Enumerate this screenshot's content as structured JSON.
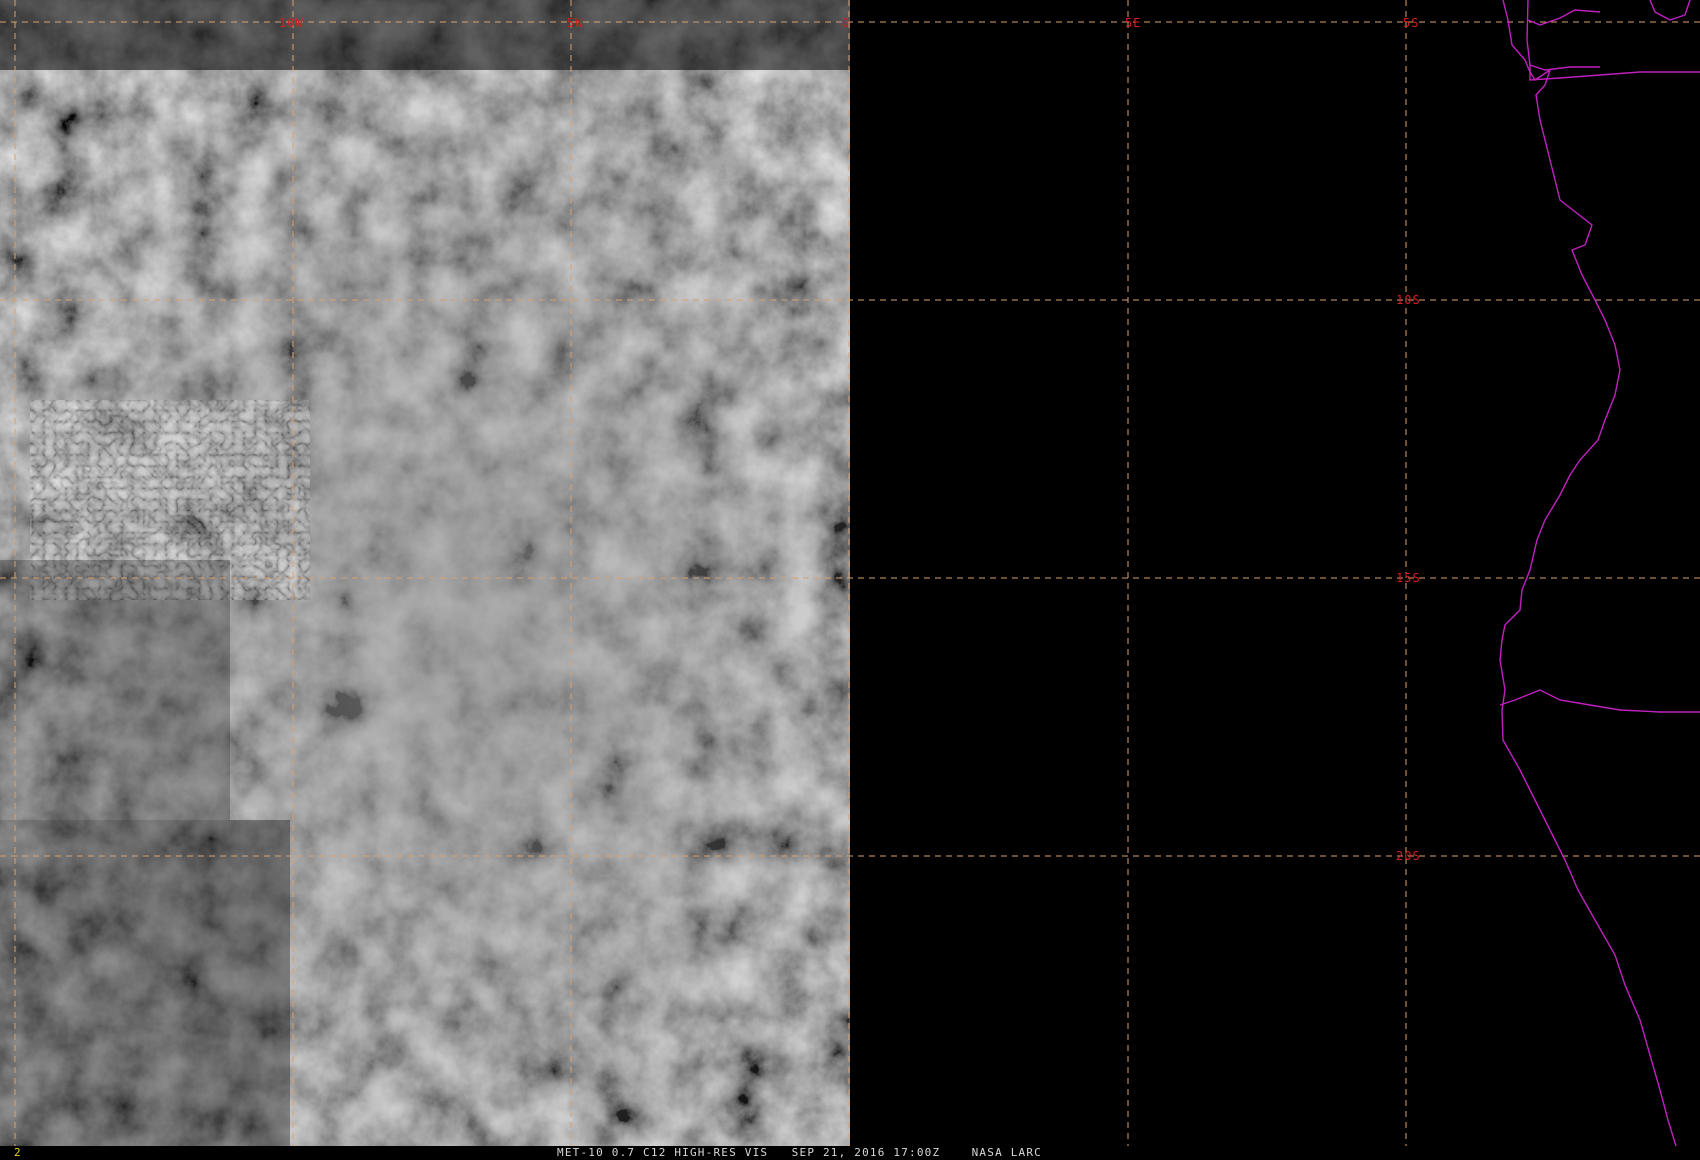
{
  "image": {
    "caption": "MET-10 0.7 C12 HIGH-RES VIS   SEP 21, 2016 17:00Z    NASA LARC",
    "frame_number": "2"
  },
  "grid": {
    "longitude_labels": [
      "10W",
      "5W",
      "0",
      "5E"
    ],
    "latitude_labels": [
      "5S",
      "10S",
      "15S",
      "20S"
    ],
    "line_color": "#d9a070",
    "label_color": "#d02020"
  },
  "coastline": {
    "color": "#c020c0"
  },
  "colors": {
    "background": "#000000",
    "cloud": "#b8b8b8",
    "ocean": "#141414"
  }
}
